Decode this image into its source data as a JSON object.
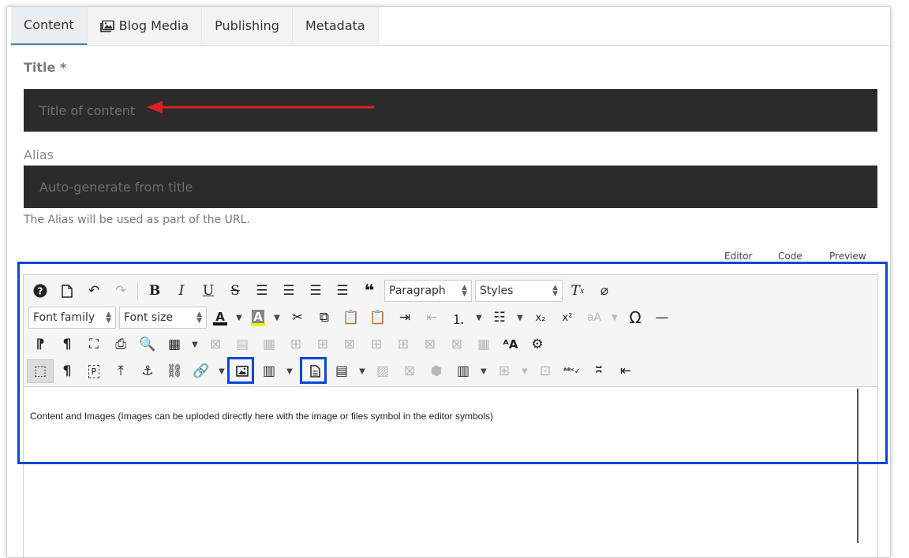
{
  "tabs": [
    {
      "label": "Content",
      "active": true
    },
    {
      "label": "Blog Media",
      "icon": "image-gallery-icon"
    },
    {
      "label": "Publishing"
    },
    {
      "label": "Metadata"
    }
  ],
  "title_field": {
    "label": "Title *",
    "placeholder": "Title of content"
  },
  "alias_field": {
    "label": "Alias",
    "placeholder": "Auto-generate from title",
    "help": "The Alias will be used as part of the URL."
  },
  "editor_modes": [
    "Editor",
    "Code",
    "Preview"
  ],
  "toolbar": {
    "paragraph_select": "Paragraph",
    "styles_select": "Styles",
    "font_family_select": "Font family",
    "font_size_select": "Font size"
  },
  "editor_content": "Content and Images (Images can be uploded directly here with the image or files symbol in the editor symbols)",
  "colors": {
    "highlight": "#0a46d8",
    "arrow": "#e02020",
    "dark_input": "#2b2b2b"
  }
}
